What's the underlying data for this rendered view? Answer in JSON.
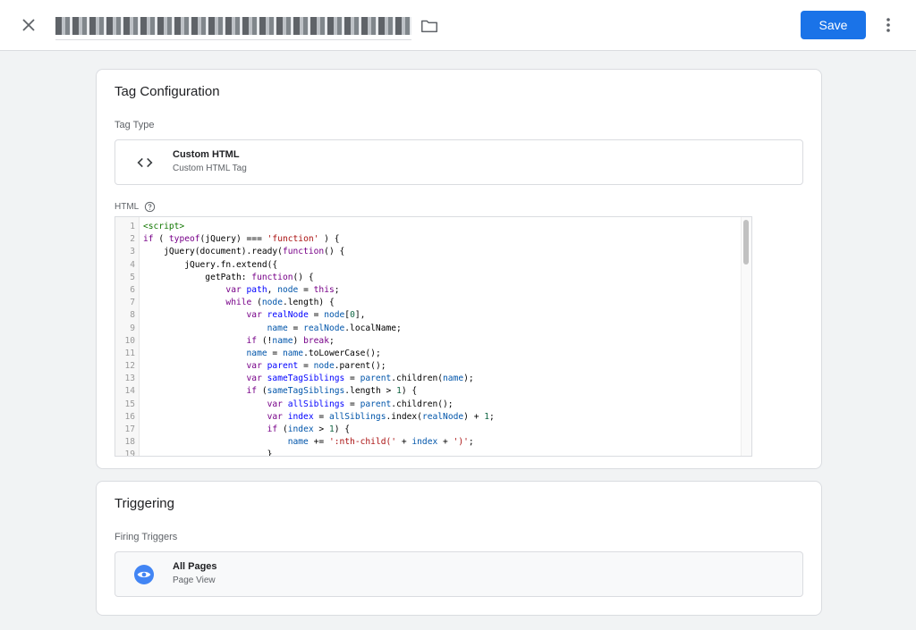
{
  "header": {
    "title": "████ ██████ ██████ ████",
    "save_label": "Save"
  },
  "tag_config": {
    "title": "Tag Configuration",
    "tag_type_label": "Tag Type",
    "tag_type": {
      "name": "Custom HTML",
      "subtitle": "Custom HTML Tag"
    },
    "html_label": "HTML",
    "code_lines": [
      "<script>",
      "if ( typeof(jQuery) === 'function' ) {",
      "    jQuery(document).ready(function($) {",
      "        jQuery.fn.extend({",
      "            getPath: function() {",
      "                var path, node = this;",
      "                while (node.length) {",
      "                    var realNode = node[0],",
      "                        name = realNode.localName;",
      "                    if (!name) break;",
      "                    name = name.toLowerCase();",
      "                    var parent = node.parent();",
      "                    var sameTagSiblings = parent.children(name);",
      "                    if (sameTagSiblings.length > 1) {",
      "                        var allSiblings = parent.children();",
      "                        var index = allSiblings.index(realNode) + 1;",
      "                        if (index > 1) {",
      "                            name += ':nth-child(' + index + ')';",
      "                        }"
    ]
  },
  "triggering": {
    "title": "Triggering",
    "firing_label": "Firing Triggers",
    "trigger": {
      "name": "All Pages",
      "subtitle": "Page View"
    }
  },
  "colors": {
    "accent": "#1a73e8",
    "trigger_icon": "#4285f4"
  }
}
